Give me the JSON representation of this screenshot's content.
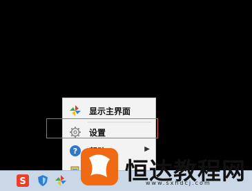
{
  "menu": {
    "items": [
      {
        "label": "显示主界面",
        "icon": "pinwheel-icon"
      },
      {
        "label": "设置",
        "icon": "gear-icon"
      },
      {
        "label": "帮助",
        "icon": "help-icon"
      }
    ]
  },
  "watermark": {
    "brand": "恒达教程网",
    "url": "www.sxhdcj.com"
  },
  "colors": {
    "highlight_border": "#e35656",
    "watermark_orange": "#f06a14"
  }
}
